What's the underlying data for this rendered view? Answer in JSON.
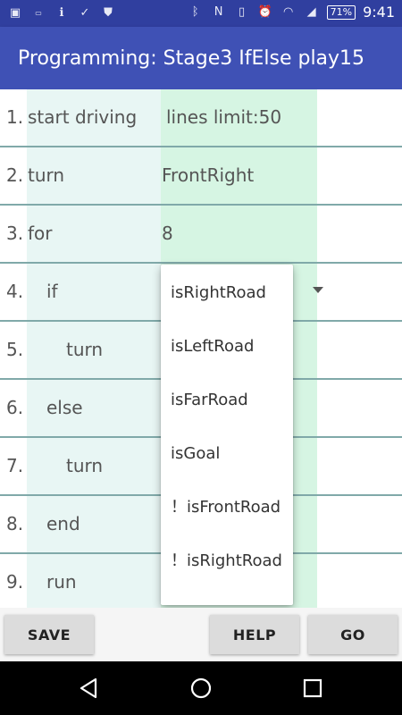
{
  "status_bar": {
    "left_icons": [
      "notification-icon",
      "pass-icon",
      "info-icon",
      "check-icon",
      "shield-icon"
    ],
    "right_icons": [
      "bluetooth-icon",
      "nfc-icon",
      "vibrate-icon",
      "alarm-icon",
      "wifi-icon",
      "signal-icon"
    ],
    "battery": "71%",
    "time": "9:41"
  },
  "app_bar": {
    "title": "Programming: Stage3 IfElse play15"
  },
  "program": {
    "rows": [
      {
        "number": "1.",
        "command": "start driving",
        "indent": 0,
        "argument": "lines limit:50"
      },
      {
        "number": "2.",
        "command": "turn",
        "indent": 0,
        "argument": "FrontRight"
      },
      {
        "number": "3.",
        "command": "for",
        "indent": 0,
        "argument": "8"
      },
      {
        "number": "4.",
        "command": "if",
        "indent": 1,
        "argument": ""
      },
      {
        "number": "5.",
        "command": "turn",
        "indent": 2,
        "argument": ""
      },
      {
        "number": "6.",
        "command": "else",
        "indent": 1,
        "argument": ""
      },
      {
        "number": "7.",
        "command": "turn",
        "indent": 2,
        "argument": ""
      },
      {
        "number": "8.",
        "command": "end",
        "indent": 1,
        "argument": ""
      },
      {
        "number": "9.",
        "command": "run",
        "indent": 1,
        "argument": ""
      }
    ]
  },
  "condition_dropdown": {
    "options": [
      "isRightRoad",
      "isLeftRoad",
      "isFarRoad",
      "isGoal",
      "！isFrontRoad",
      "！isRightRoad"
    ]
  },
  "buttons": {
    "save": "SAVE",
    "help": "HELP",
    "go": "GO"
  },
  "nav_bar": [
    "back-icon",
    "home-icon",
    "recents-icon"
  ],
  "colors": {
    "status_bar": "#303F9F",
    "app_bar": "#3F51B5",
    "command_column": "#e8f6f4",
    "argument_column": "#d6f5e3",
    "row_divider": "#80a9a9"
  }
}
